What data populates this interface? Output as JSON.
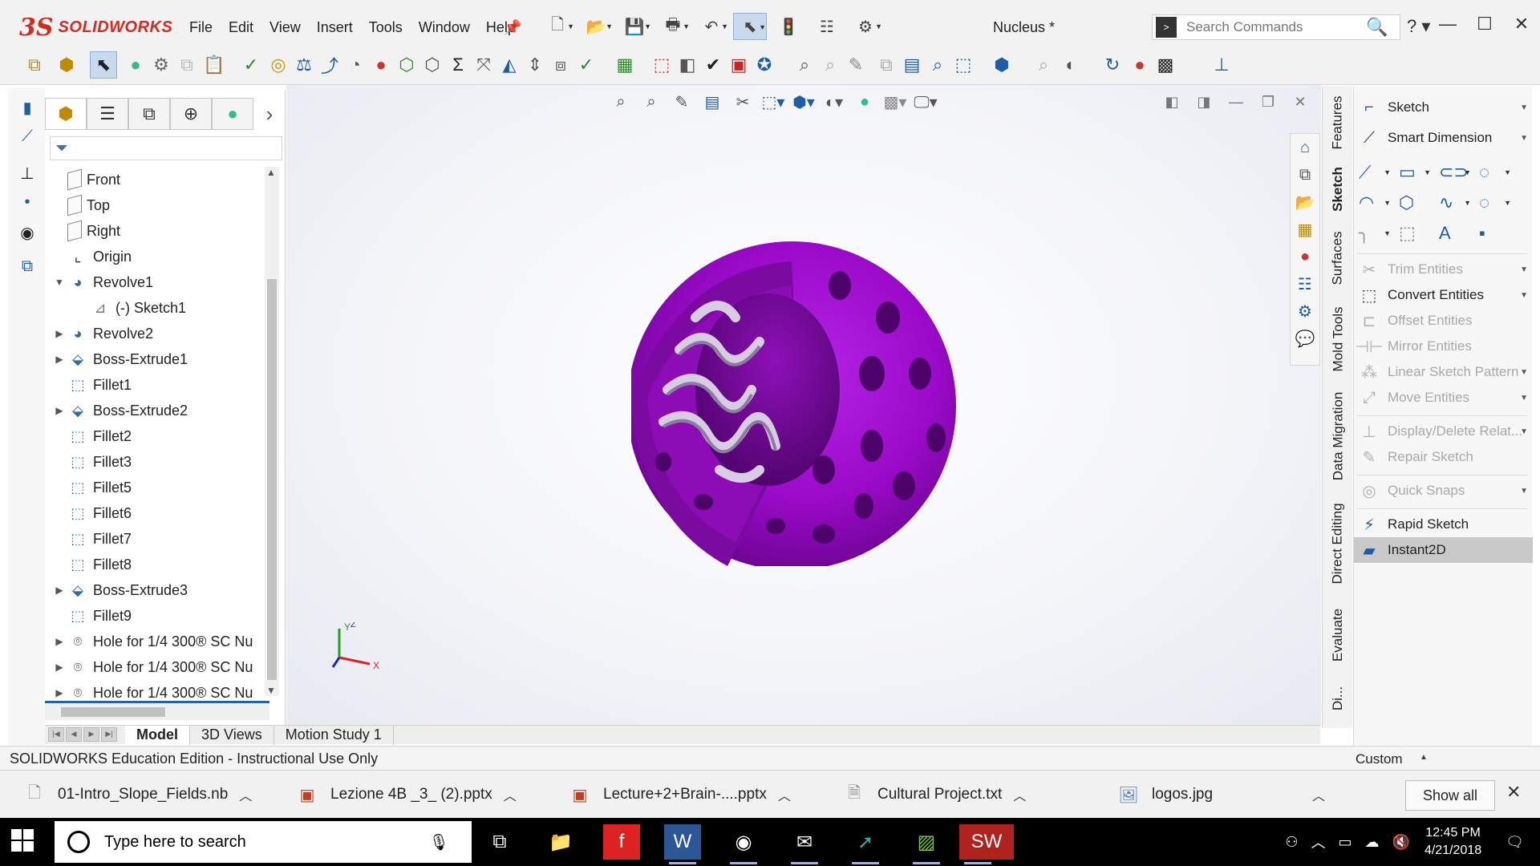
{
  "app": {
    "logo_ds": "3S",
    "logo_text": "SOLIDWORKS",
    "document_title": "Nucleus *",
    "search_placeholder": "Search Commands"
  },
  "menu": [
    "File",
    "Edit",
    "View",
    "Insert",
    "Tools",
    "Window",
    "Help"
  ],
  "feature_tree": [
    {
      "label": "Front",
      "icon": "plane-icon",
      "expand": ""
    },
    {
      "label": "Top",
      "icon": "plane-icon",
      "expand": ""
    },
    {
      "label": "Right",
      "icon": "plane-icon",
      "expand": ""
    },
    {
      "label": "Origin",
      "icon": "origin-icon",
      "expand": ""
    },
    {
      "label": "Revolve1",
      "icon": "revolve-icon",
      "expand": "▼"
    },
    {
      "label": "(-) Sketch1",
      "icon": "sketch-icon",
      "expand": "",
      "indent": true
    },
    {
      "label": "Revolve2",
      "icon": "revolve-icon",
      "expand": "▶"
    },
    {
      "label": "Boss-Extrude1",
      "icon": "extrude-icon",
      "expand": "▶"
    },
    {
      "label": "Fillet1",
      "icon": "fillet-icon",
      "expand": ""
    },
    {
      "label": "Boss-Extrude2",
      "icon": "extrude-icon",
      "expand": "▶"
    },
    {
      "label": "Fillet2",
      "icon": "fillet-icon",
      "expand": ""
    },
    {
      "label": "Fillet3",
      "icon": "fillet-icon",
      "expand": ""
    },
    {
      "label": "Fillet5",
      "icon": "fillet-icon",
      "expand": ""
    },
    {
      "label": "Fillet6",
      "icon": "fillet-icon",
      "expand": ""
    },
    {
      "label": "Fillet7",
      "icon": "fillet-icon",
      "expand": ""
    },
    {
      "label": "Fillet8",
      "icon": "fillet-icon",
      "expand": ""
    },
    {
      "label": "Boss-Extrude3",
      "icon": "extrude-icon",
      "expand": "▶"
    },
    {
      "label": "Fillet9",
      "icon": "fillet-icon",
      "expand": ""
    },
    {
      "label": "Hole for 1/4 300® SC Nu",
      "icon": "hole-icon",
      "expand": "▶"
    },
    {
      "label": "Hole for 1/4 300® SC Nu",
      "icon": "hole-icon",
      "expand": "▶"
    },
    {
      "label": "Hole for 1/4 300® SC Nu",
      "icon": "hole-icon",
      "expand": "▶"
    }
  ],
  "vertical_tabs": [
    "Features",
    "Sketch",
    "Surfaces",
    "Mold Tools",
    "Data Migration",
    "Direct Editing",
    "Evaluate",
    "Di..."
  ],
  "sketch_panel": {
    "sketch": "Sketch",
    "smart_dimension": "Smart Dimension",
    "trim_entities": "Trim Entities",
    "convert_entities": "Convert Entities",
    "offset_entities": "Offset Entities",
    "mirror_entities": "Mirror Entities",
    "linear_sketch_pattern": "Linear Sketch Pattern",
    "move_entities": "Move Entities",
    "display_delete_relations": "Display/Delete Relat...",
    "repair_sketch": "Repair Sketch",
    "quick_snaps": "Quick Snaps",
    "rapid_sketch": "Rapid Sketch",
    "instant2d": "Instant2D"
  },
  "bottom_tabs": [
    "Model",
    "3D Views",
    "Motion Study 1"
  ],
  "status": {
    "text": "SOLIDWORKS Education Edition - Instructional Use Only",
    "custom": "Custom"
  },
  "triad": {
    "x": "X",
    "y": "Y",
    "z": "Z"
  },
  "downloads": [
    {
      "name": "01-Intro_Slope_Fields.nb",
      "type": "file-icon"
    },
    {
      "name": "Lezione 4B _3_ (2).pptx",
      "type": "pptx-icon"
    },
    {
      "name": "Lecture+2+Brain-....pptx",
      "type": "pptx-icon"
    },
    {
      "name": "Cultural Project.txt",
      "type": "txt-icon"
    },
    {
      "name": "logos.jpg",
      "type": "image-icon"
    }
  ],
  "downloads_show_all": "Show all",
  "taskbar": {
    "search_placeholder": "Type here to search",
    "time": "12:45 PM",
    "date": "4/21/2018"
  },
  "colors": {
    "model_purple": "#9b0ec4",
    "model_dark": "#6a0590",
    "ribbon_gray": "#c8c0d8",
    "accent_blue": "#1e64b4"
  }
}
